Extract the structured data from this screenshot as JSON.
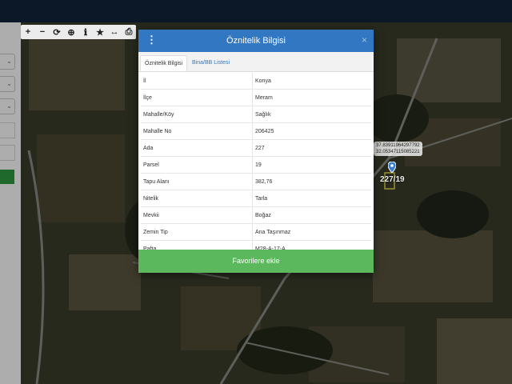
{
  "map": {
    "toolbar": [
      {
        "name": "zoom-in",
        "glyph": "+"
      },
      {
        "name": "zoom-out",
        "glyph": "−"
      },
      {
        "name": "refresh",
        "glyph": "⟳"
      },
      {
        "name": "locate",
        "glyph": "⊕"
      },
      {
        "name": "info",
        "glyph": "ℹ"
      },
      {
        "name": "favorite",
        "glyph": "★"
      },
      {
        "name": "measure",
        "glyph": "↔"
      },
      {
        "name": "print",
        "glyph": "⎙"
      }
    ],
    "coordinates": {
      "line1": "37.83911964297792",
      "line2": "32.05347115085221"
    },
    "parcel_label": "227/19",
    "pin_color": "#3b7fd0"
  },
  "dialog": {
    "title": "Öznitelik Bilgisi",
    "menu_icon": "⋮",
    "close_icon": "×",
    "tabs": [
      {
        "label": "Öznitelik Bilgisi",
        "active": true
      },
      {
        "label": "Bina/BB Listesi",
        "active": false
      }
    ],
    "attributes": [
      {
        "key": "İl",
        "value": "Konya"
      },
      {
        "key": "İlçe",
        "value": "Meram"
      },
      {
        "key": "Mahalle/Köy",
        "value": "Sağlık"
      },
      {
        "key": "Mahalle No",
        "value": "206425"
      },
      {
        "key": "Ada",
        "value": "227"
      },
      {
        "key": "Parsel",
        "value": "19"
      },
      {
        "key": "Tapu Alanı",
        "value": "382,76"
      },
      {
        "key": "Nitelik",
        "value": "Tarla"
      },
      {
        "key": "Mevkii",
        "value": "Boğaz"
      },
      {
        "key": "Zemin Tip",
        "value": "Ana Taşınmaz"
      },
      {
        "key": "Pafta",
        "value": "M28-A-17-A"
      }
    ],
    "footer_button": "Favorilere ekle",
    "header_color": "#3277c1",
    "footer_color": "#5cb85c"
  }
}
